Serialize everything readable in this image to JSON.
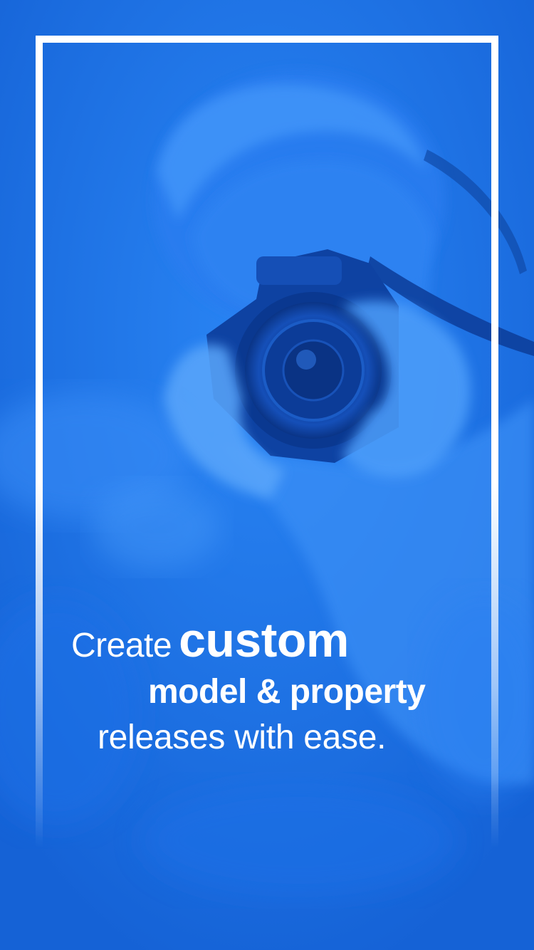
{
  "colors": {
    "background": "#1766dc",
    "frame": "#ffffff",
    "text": "#ffffff"
  },
  "illustration": "photographer-with-camera-blue-duotone",
  "headline": {
    "line1_light": "Create",
    "line1_bold": "custom",
    "line2": "model & property",
    "line3": "releases with ease."
  }
}
